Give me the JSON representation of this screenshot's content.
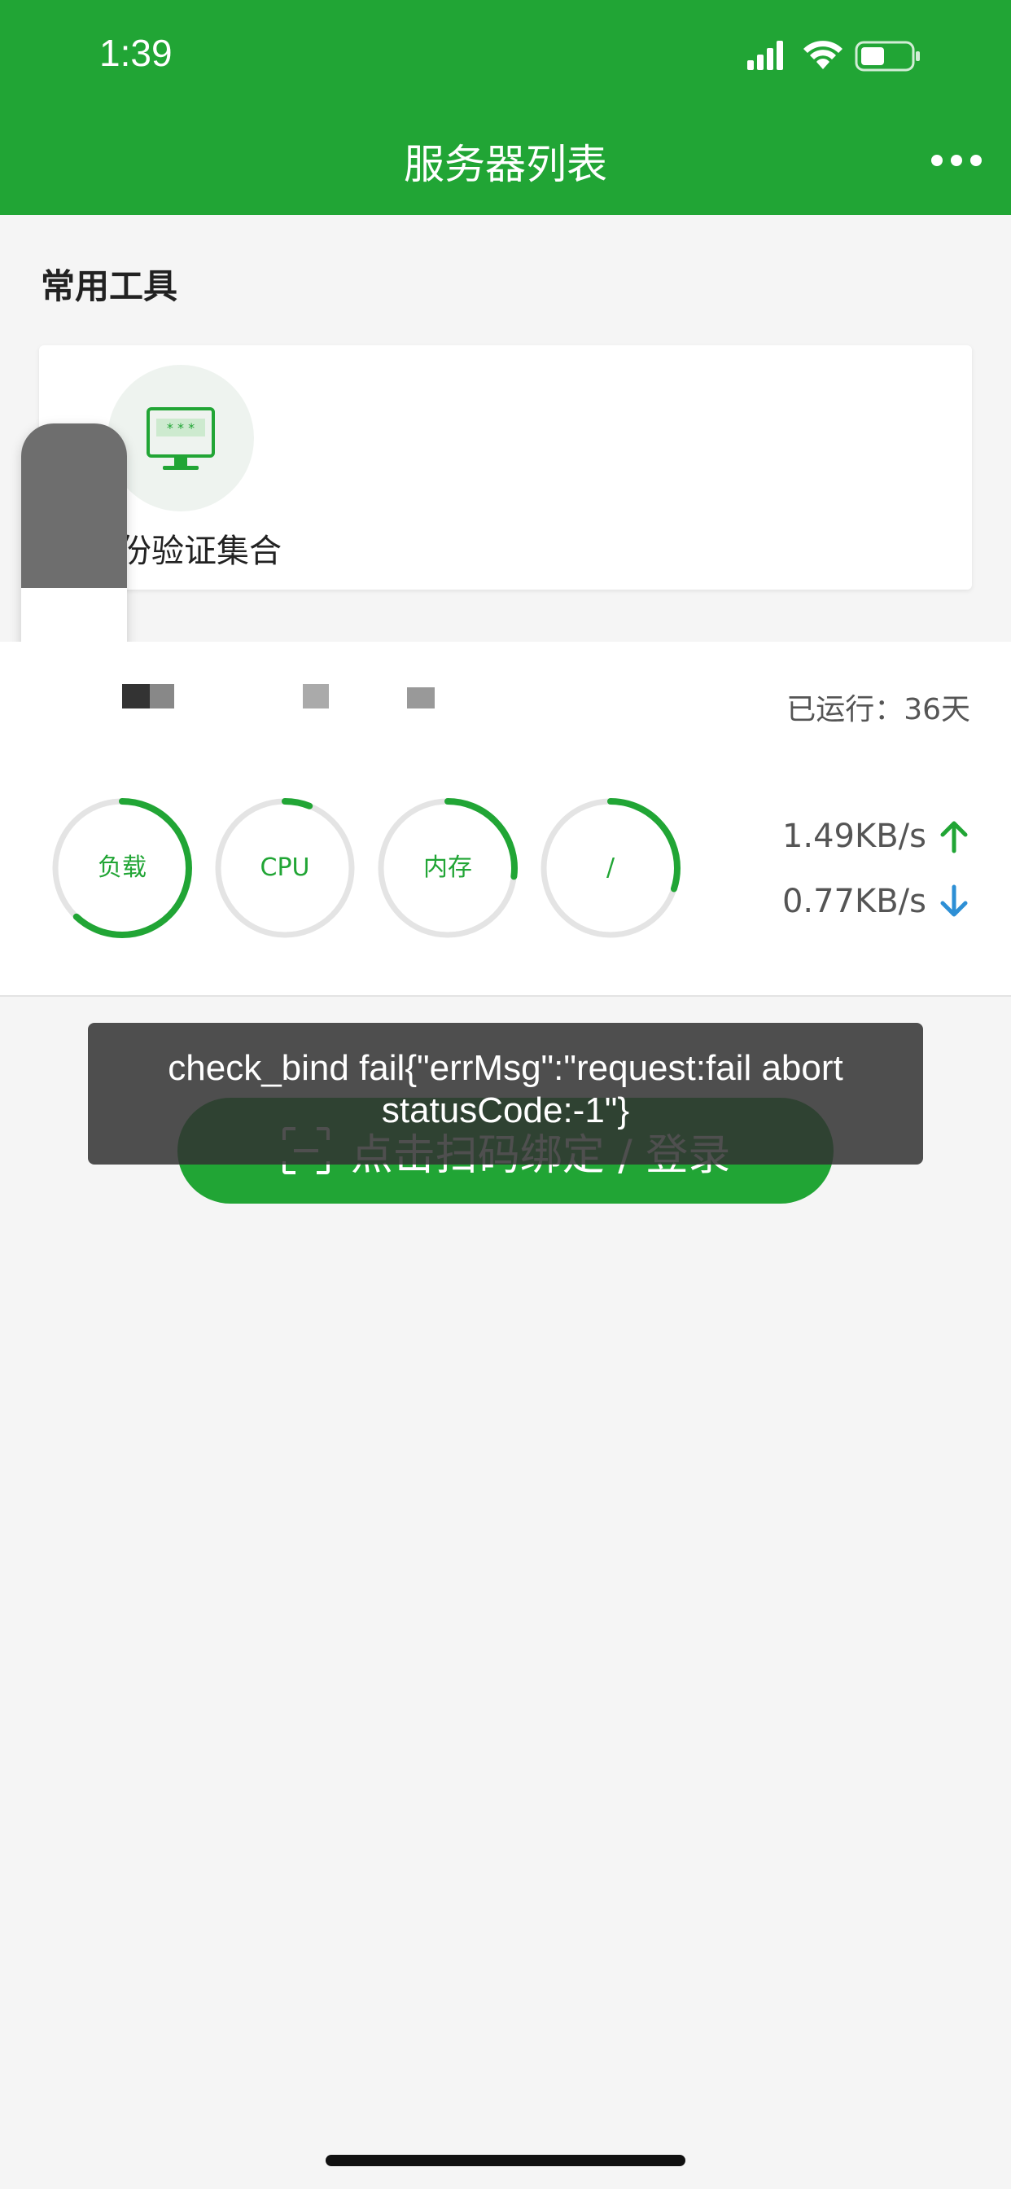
{
  "status_bar": {
    "time": "1:39"
  },
  "nav": {
    "title": "服务器列表"
  },
  "tools": {
    "section_title": "常用工具",
    "items": [
      {
        "label": "份验证集合",
        "icon": "monitor-password-icon"
      }
    ]
  },
  "server": {
    "uptime": "已运行：36天",
    "gauges": [
      {
        "label": "负载",
        "fraction": 0.62
      },
      {
        "label": "CPU",
        "fraction": 0.06
      },
      {
        "label": "内存",
        "fraction": 0.27
      },
      {
        "label": "/",
        "fraction": 0.3
      }
    ],
    "upload_speed": "1.49KB/s",
    "download_speed": "0.77KB/s"
  },
  "bind_button": {
    "label": "点击扫码绑定 / 登录"
  },
  "toast": {
    "message": "check_bind fail{\"errMsg\":\"request:fail abort statusCode:-1\"}"
  },
  "colors": {
    "accent": "#21a535",
    "gauge_track": "#e4e4e4",
    "upload_arrow": "#21a535",
    "download_arrow": "#2d8fd5"
  }
}
